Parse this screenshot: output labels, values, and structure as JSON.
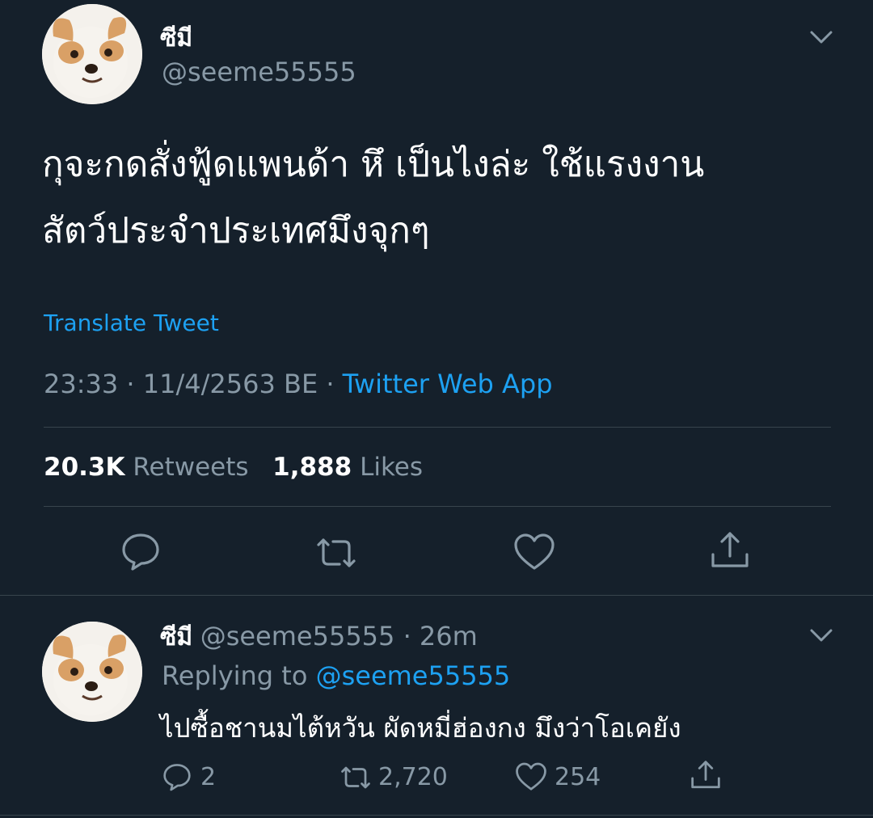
{
  "main_tweet": {
    "display_name": "ซีมี",
    "handle": "@seeme55555",
    "text_line1": "กุจะกดสั่งฟู้ดแพนด้า หึ เป็นไงล่ะ ใช้แรงงาน",
    "text_line2": "สัตว์ประจำประเทศมึงจุกๆ",
    "translate": "Translate Tweet",
    "time": "23:33",
    "sep1": "·",
    "date": "11/4/2563 BE",
    "sep2": "·",
    "source": "Twitter Web App",
    "retweets_count": "20.3K",
    "retweets_label": "Retweets",
    "likes_count": "1,888",
    "likes_label": "Likes"
  },
  "reply_tweet": {
    "display_name": "ซีมี",
    "handle_time": "@seeme55555 · 26m",
    "replying_prefix": "Replying to",
    "replying_handle": "@seeme55555",
    "text": "ไปซื้อชานมไต้หวัน ผัดหมี่ฮ่องกง มึงว่าโอเคยัง",
    "reply_count": "2",
    "retweet_count": "2,720",
    "like_count": "254"
  },
  "colors": {
    "background": "#15202b",
    "text": "#ffffff",
    "muted": "#8899a6",
    "link": "#1da1f2",
    "divider": "#38444d"
  },
  "icons": [
    "chevron-down-icon",
    "reply-icon",
    "retweet-icon",
    "like-icon",
    "share-icon"
  ]
}
